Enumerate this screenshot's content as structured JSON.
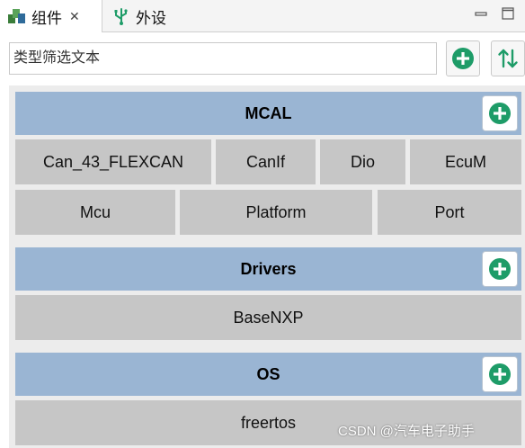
{
  "tabs": [
    {
      "label": "组件",
      "icon": "components-icon",
      "active": true
    },
    {
      "label": "外设",
      "icon": "usb-icon",
      "active": false
    }
  ],
  "filter": {
    "placeholder": "类型筛选文本"
  },
  "groups": [
    {
      "title": "MCAL",
      "items": [
        "Can_43_FLEXCAN",
        "CanIf",
        "Dio",
        "EcuM",
        "Mcu",
        "Platform",
        "Port"
      ]
    },
    {
      "title": "Drivers",
      "items": [
        "BaseNXP"
      ]
    },
    {
      "title": "OS",
      "items": [
        "freertos"
      ]
    }
  ],
  "watermark": "CSDN @汽车电子助手",
  "colors": {
    "header": "#9ab5d3",
    "cell": "#c6c6c6",
    "accent_green": "#1e9c68",
    "panel_bg": "#ececec"
  }
}
